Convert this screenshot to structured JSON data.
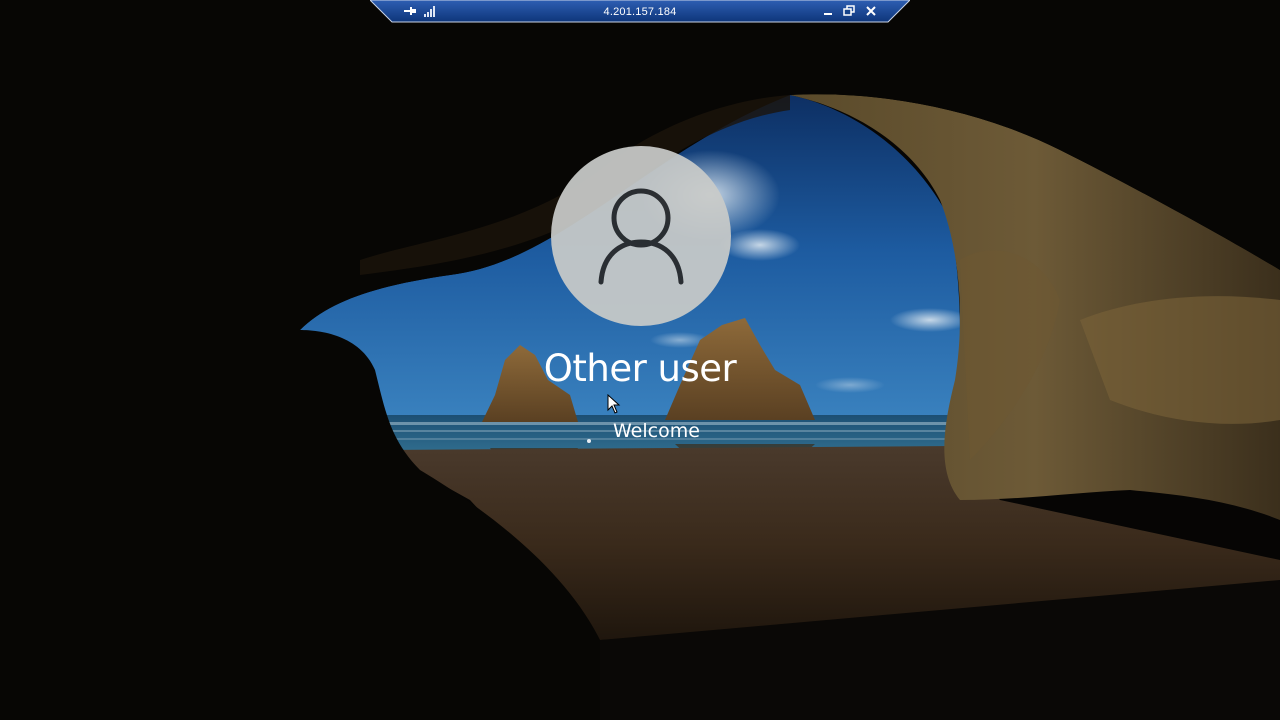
{
  "remote_bar": {
    "title": "4.201.157.184",
    "pin_icon": "pin-icon",
    "signal_icon": "connection-signal-icon",
    "minimize_icon": "minimize-icon",
    "restore_icon": "restore-icon",
    "close_icon": "close-icon",
    "bar_color": "#123f8c"
  },
  "login": {
    "avatar_icon": "user-silhouette-icon",
    "user_name": "Other user",
    "status": "Welcome",
    "spinner_icon": "loading-dot-icon"
  },
  "pointer": {
    "icon": "mouse-cursor-icon"
  },
  "wallpaper": {
    "description_icon": "beach-cave-wallpaper"
  }
}
